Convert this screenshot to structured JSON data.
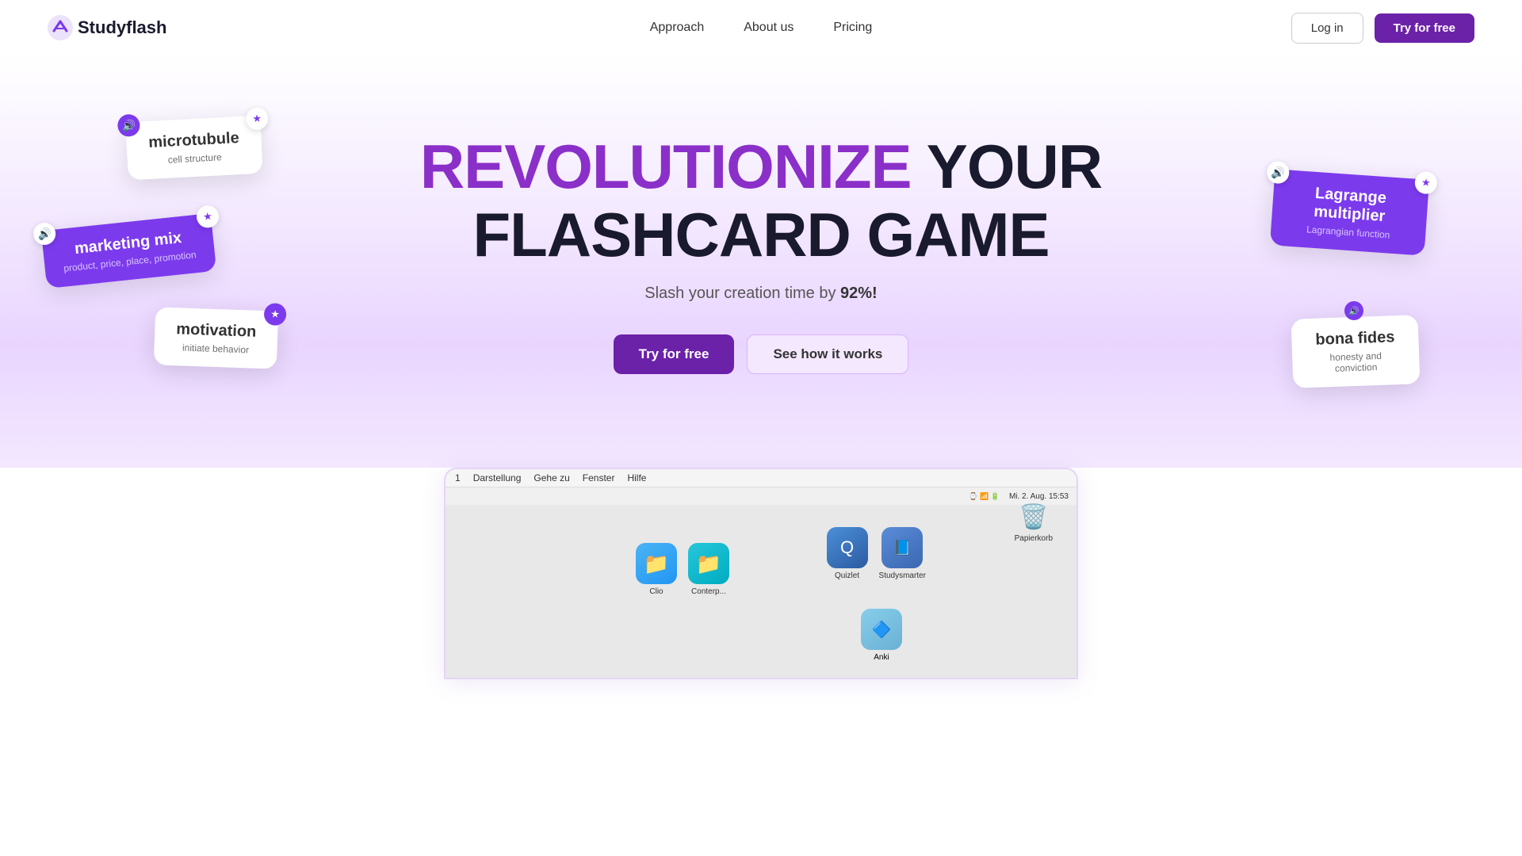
{
  "nav": {
    "logo_text": "Studyflash",
    "links": [
      {
        "label": "Approach",
        "href": "#"
      },
      {
        "label": "About us",
        "href": "#"
      },
      {
        "label": "Pricing",
        "href": "#"
      }
    ],
    "login_label": "Log in",
    "try_label": "Try for free"
  },
  "hero": {
    "title_part1": "REVOLUTIONIZE",
    "title_part2": " YOUR",
    "title_line2": "FLASHCARD GAME",
    "subtitle_pre": "Slash your creation time by ",
    "subtitle_highlight": "92%!",
    "btn_primary": "Try for free",
    "btn_secondary": "See how it works"
  },
  "cards": {
    "microtubule": {
      "term": "microtubule",
      "def": "cell structure"
    },
    "marketing": {
      "term": "marketing mix",
      "def": "product, price, place, promotion"
    },
    "motivation": {
      "term": "motivation",
      "def": "initiate behavior"
    },
    "lagrange": {
      "term": "Lagrange multiplier",
      "def": "Lagrangian function"
    },
    "bona": {
      "term": "bona fides",
      "def": "honesty and conviction"
    }
  },
  "browser": {
    "menu_items": [
      "Darstellung",
      "Gehe zu",
      "Fenster",
      "Hilfe"
    ],
    "timestamp": "Mi. 2. Aug.  15:53",
    "folders": [
      {
        "label": "Clio",
        "type": "blue"
      },
      {
        "label": "Conterp...",
        "type": "teal"
      }
    ],
    "apps_right": [
      {
        "label": "Quizlet",
        "type": "quizlet"
      },
      {
        "label": "Studysmarter",
        "type": "studysmarter"
      }
    ],
    "apps_bottom": [
      {
        "label": "Anki",
        "type": "anki"
      }
    ],
    "trash_label": "Papierkorb"
  }
}
